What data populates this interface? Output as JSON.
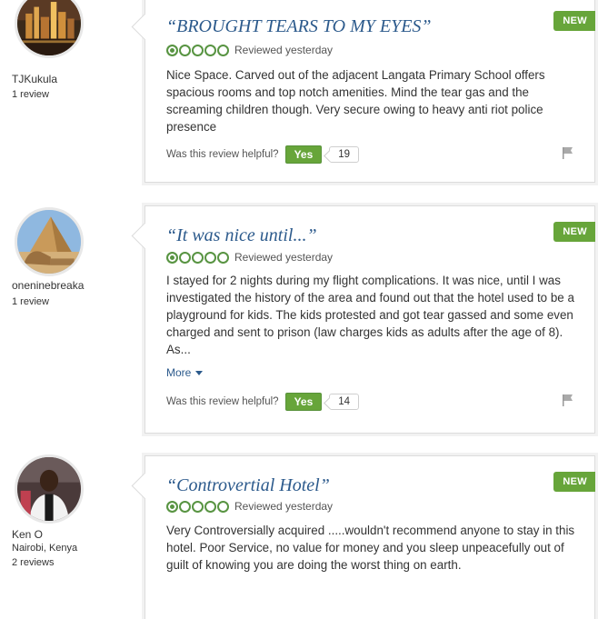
{
  "colors": {
    "brand_green": "#67a53a",
    "title_blue": "#2c5a8c",
    "bubble_green": "#589442"
  },
  "reviews": [
    {
      "username": "TJKukula",
      "location": "",
      "review_count": "1 review",
      "avatar_icon": "city-skyline-photo",
      "badge": "NEW",
      "title": "“BROUGHT TEARS TO MY EYES”",
      "rating": 1,
      "date": "Reviewed yesterday",
      "body": "Nice Space. Carved out of the adjacent Langata Primary School offers spacious rooms and top notch amenities. Mind the tear gas and the screaming children though. Very secure owing to heavy anti riot police presence",
      "more_label": "",
      "helpful_label": "Was this review helpful?",
      "yes_label": "Yes",
      "yes_count": "19"
    },
    {
      "username": "oneninebreaka",
      "location": "",
      "review_count": "1 review",
      "avatar_icon": "sphinx-pyramid-photo",
      "badge": "NEW",
      "title": "“It was nice until...”",
      "rating": 1,
      "date": "Reviewed yesterday",
      "body": "I stayed for 2 nights during my flight complications. It was nice, until I was investigated the history of the area and found out that the hotel used to be a playground for kids. The kids protested and got tear gassed and some even charged and sent to prison (law charges kids as adults after the age of 8). As...",
      "more_label": "More",
      "helpful_label": "Was this review helpful?",
      "yes_label": "Yes",
      "yes_count": "14"
    },
    {
      "username": "Ken O",
      "location": "Nairobi, Kenya",
      "review_count": "2 reviews",
      "avatar_icon": "person-photo",
      "badge": "NEW",
      "title": "“Controvertial Hotel”",
      "rating": 1,
      "date": "Reviewed yesterday",
      "body": "Very Controversially acquired .....wouldn't recommend anyone to stay in this hotel. Poor Service, no value for money and you sleep unpeacefully out of guilt of knowing you are doing the worst thing on earth.",
      "more_label": "",
      "helpful_label": "",
      "yes_label": "",
      "yes_count": ""
    }
  ]
}
